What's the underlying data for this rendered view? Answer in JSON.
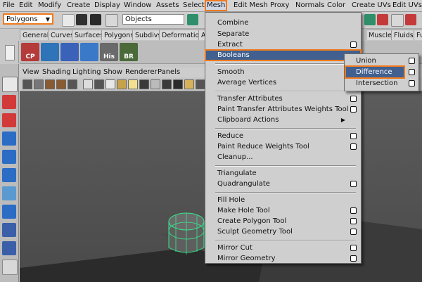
{
  "menubar": {
    "items": [
      "File",
      "Edit",
      "Modify",
      "Create",
      "Display",
      "Window",
      "Assets",
      "Select",
      "Mesh",
      "Edit Mesh",
      "Proxy",
      "Normals",
      "Color",
      "Create UVs",
      "Edit UVs"
    ],
    "active": "Mesh"
  },
  "statusline": {
    "mode": "Polygons",
    "objects_field": "Objects"
  },
  "shelf": {
    "tabs": [
      "General",
      "Curves",
      "Surfaces",
      "Polygons",
      "Subdivs",
      "Deformation",
      "A",
      "Muscle",
      "Fluids",
      "Fu"
    ],
    "icons": [
      {
        "name": "cp-icon",
        "label": "CP"
      },
      {
        "name": "cube-shelf-icon",
        "label": ""
      },
      {
        "name": "grid-icon",
        "label": ""
      },
      {
        "name": "soft-mod-icon",
        "label": ""
      },
      {
        "name": "his-icon",
        "label": "His"
      },
      {
        "name": "br-icon",
        "label": "BR"
      }
    ]
  },
  "panel": {
    "menu": [
      "View",
      "Shading",
      "Lighting",
      "Show",
      "Renderer",
      "Panels"
    ]
  },
  "mesh_menu": {
    "items": [
      {
        "label": "Combine",
        "option": false,
        "submenu": false
      },
      {
        "label": "Separate",
        "option": false,
        "submenu": false
      },
      {
        "label": "Extract",
        "option": true,
        "submenu": false
      },
      {
        "label": "Booleans",
        "option": false,
        "submenu": true,
        "highlighted": true
      },
      {
        "label": "Smooth",
        "option": true,
        "submenu": false
      },
      {
        "label": "Average Vertices",
        "option": true,
        "submenu": false
      },
      {
        "label": "Transfer Attributes",
        "option": true,
        "submenu": false
      },
      {
        "label": "Paint Transfer Attributes Weights Tool",
        "option": true,
        "submenu": false
      },
      {
        "label": "Clipboard Actions",
        "option": false,
        "submenu": true
      },
      {
        "label": "Reduce",
        "option": true,
        "submenu": false
      },
      {
        "label": "Paint Reduce Weights Tool",
        "option": true,
        "submenu": false
      },
      {
        "label": "Cleanup...",
        "option": false,
        "submenu": false
      },
      {
        "label": "Triangulate",
        "option": false,
        "submenu": false
      },
      {
        "label": "Quadrangulate",
        "option": true,
        "submenu": false
      },
      {
        "label": "Fill Hole",
        "option": false,
        "submenu": false
      },
      {
        "label": "Make Hole Tool",
        "option": true,
        "submenu": false
      },
      {
        "label": "Create Polygon Tool",
        "option": true,
        "submenu": false
      },
      {
        "label": "Sculpt Geometry Tool",
        "option": true,
        "submenu": false
      },
      {
        "label": "Mirror Cut",
        "option": true,
        "submenu": false
      },
      {
        "label": "Mirror Geometry",
        "option": true,
        "submenu": false
      }
    ]
  },
  "booleans_menu": {
    "items": [
      {
        "label": "Union",
        "option": true
      },
      {
        "label": "Difference",
        "option": true,
        "highlighted": true
      },
      {
        "label": "Intersection",
        "option": true
      }
    ]
  },
  "colors": {
    "highlight": "#41608f",
    "callout": "#f07a1e",
    "mesh_wire": "#37e88c"
  }
}
